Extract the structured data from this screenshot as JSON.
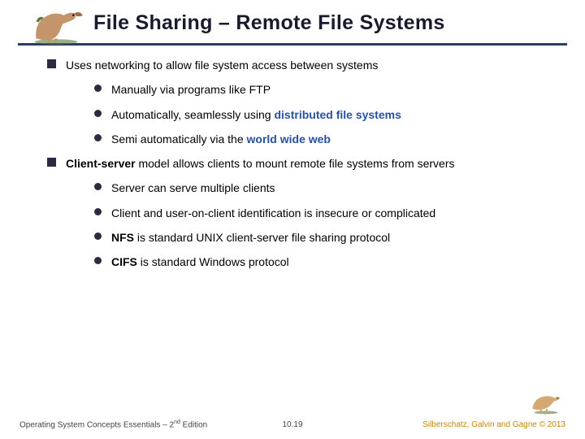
{
  "title": "File Sharing – Remote File Systems",
  "bullets": [
    {
      "text": "Uses networking to allow file system access between systems",
      "sub": [
        {
          "pre": "Manually via programs like FTP"
        },
        {
          "pre": "Automatically, seamlessly using ",
          "kw": "distributed file systems",
          "kwClass": "kw-blue"
        },
        {
          "pre": "Semi automatically via the ",
          "kw": "world wide web",
          "kwClass": "kw-blue"
        }
      ]
    },
    {
      "kw": "Client-server",
      "kwClass": "kw-bold",
      "post": " model allows clients to mount remote file systems from servers",
      "sub": [
        {
          "pre": "Server can serve multiple clients"
        },
        {
          "pre": "Client and user-on-client identification is insecure or complicated"
        },
        {
          "kw": "NFS",
          "kwClass": "kw-bold",
          "post": " is standard UNIX client-server file sharing protocol"
        },
        {
          "kw": "CIFS",
          "kwClass": "kw-bold",
          "post": " is standard Windows protocol"
        }
      ]
    }
  ],
  "footer": {
    "leftA": "Operating System Concepts Essentials – 2",
    "leftSup": "nd",
    "leftB": " Edition",
    "center": "10.19",
    "right": "Silberschatz, Galvin and Gagne © 2013"
  }
}
